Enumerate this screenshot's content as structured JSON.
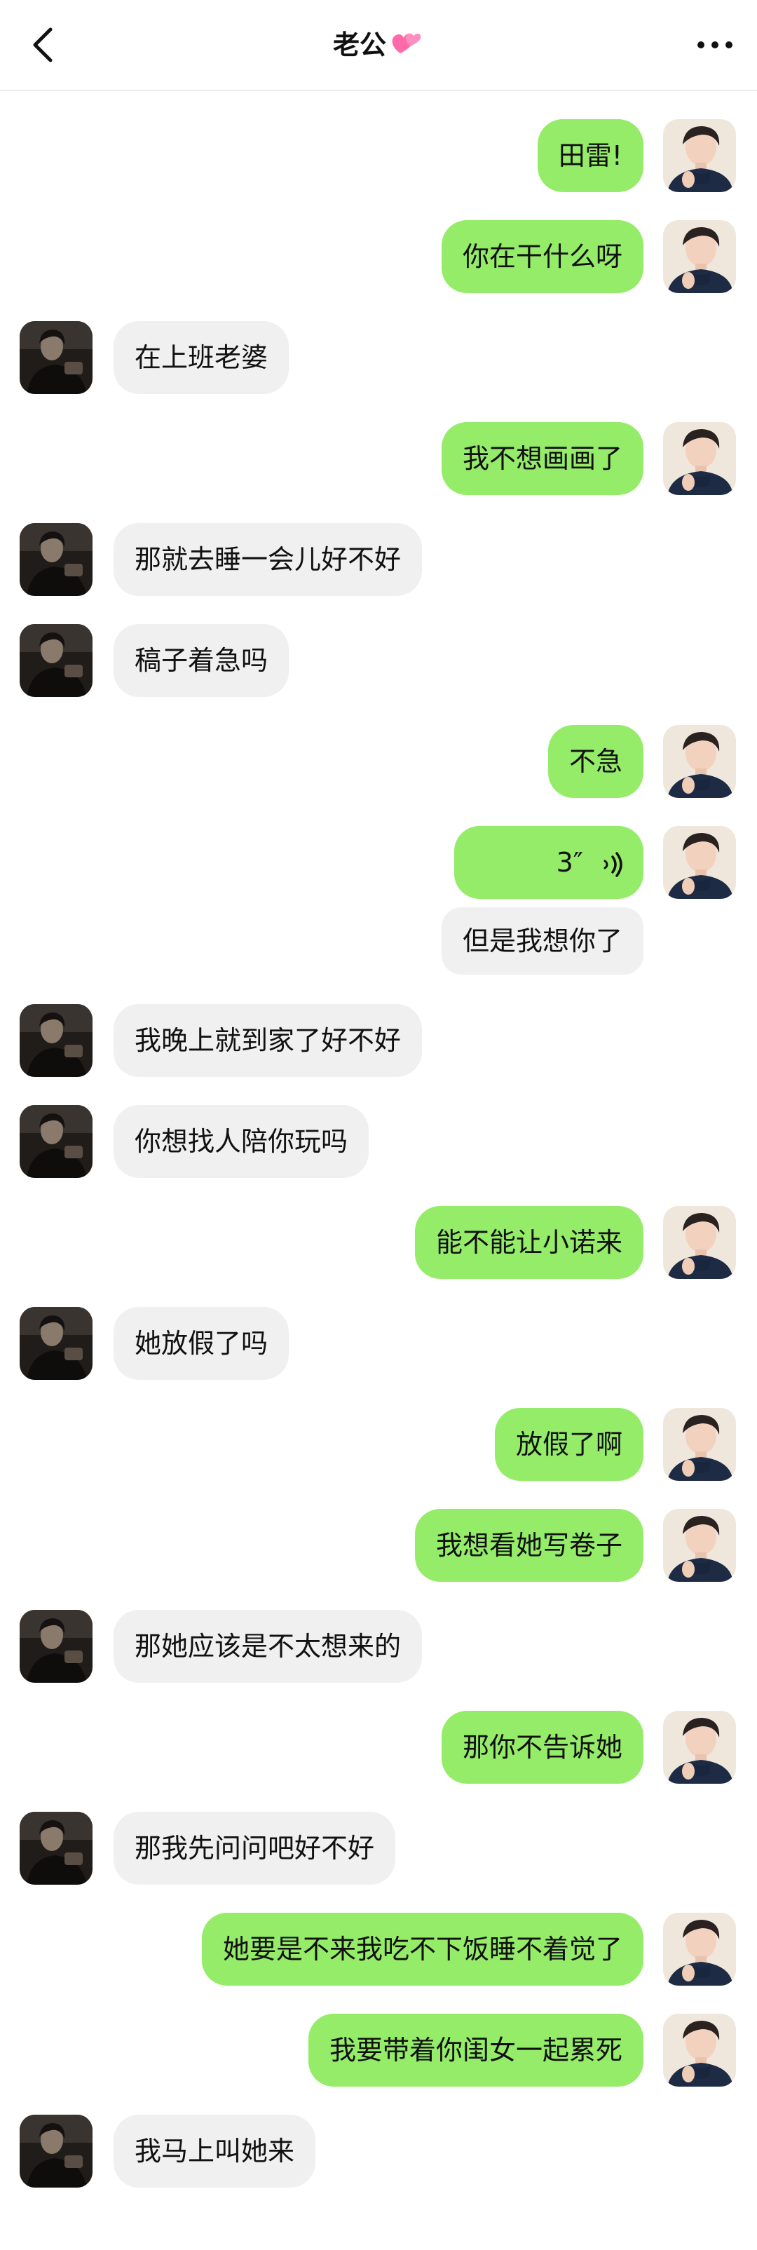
{
  "header": {
    "back_icon": "chevron-left-icon",
    "title": "老公",
    "title_emoji": "💞",
    "more_icon": "more-dots-icon"
  },
  "colors": {
    "my_bubble": "#95ec69",
    "other_bubble": "#f0f0f0",
    "background": "#ffffff"
  },
  "messages": [
    {
      "from": "me",
      "text": "田雷!"
    },
    {
      "from": "me",
      "text": "你在干什么呀"
    },
    {
      "from": "other",
      "text": "在上班老婆"
    },
    {
      "from": "me",
      "text": "我不想画画了"
    },
    {
      "from": "other",
      "text": "那就去睡一会儿好不好"
    },
    {
      "from": "other",
      "text": "稿子着急吗"
    },
    {
      "from": "me",
      "text": "不急"
    },
    {
      "from": "me",
      "type": "voice",
      "text": "3″"
    },
    {
      "from": "me",
      "type": "transcript",
      "text": "但是我想你了"
    },
    {
      "from": "other",
      "text": "我晚上就到家了好不好"
    },
    {
      "from": "other",
      "text": "你想找人陪你玩吗"
    },
    {
      "from": "me",
      "text": "能不能让小诺来"
    },
    {
      "from": "other",
      "text": "她放假了吗"
    },
    {
      "from": "me",
      "text": "放假了啊"
    },
    {
      "from": "me",
      "text": "我想看她写卷子"
    },
    {
      "from": "other",
      "text": "那她应该是不太想来的"
    },
    {
      "from": "me",
      "text": "那你不告诉她"
    },
    {
      "from": "other",
      "text": "那我先问问吧好不好"
    },
    {
      "from": "me",
      "text": "她要是不来我吃不下饭睡不着觉了"
    },
    {
      "from": "me",
      "text": "我要带着你闺女一起累死"
    },
    {
      "from": "other",
      "text": "我马上叫她来"
    }
  ]
}
